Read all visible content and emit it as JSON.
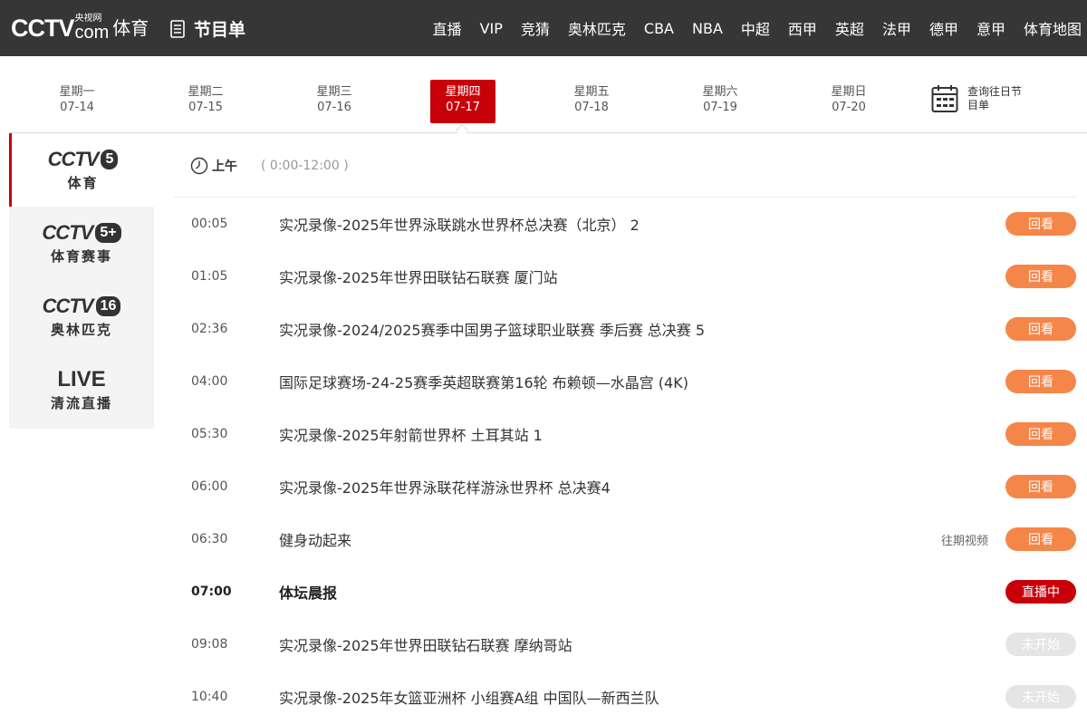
{
  "header": {
    "logo_main": "CCTV",
    "logo_small": "央视网",
    "logo_com": "com",
    "logo_sport": "体育",
    "page_title": "节目单",
    "nav": [
      "直播",
      "VIP",
      "竞猜",
      "奥林匹克",
      "CBA",
      "NBA",
      "中超",
      "西甲",
      "英超",
      "法甲",
      "德甲",
      "意甲",
      "体育地图"
    ]
  },
  "dates": [
    {
      "weekday": "星期一",
      "date": "07-14"
    },
    {
      "weekday": "星期二",
      "date": "07-15"
    },
    {
      "weekday": "星期三",
      "date": "07-16"
    },
    {
      "weekday": "星期四",
      "date": "07-17",
      "active": true
    },
    {
      "weekday": "星期五",
      "date": "07-18"
    },
    {
      "weekday": "星期六",
      "date": "07-19"
    },
    {
      "weekday": "星期日",
      "date": "07-20"
    }
  ],
  "history_label": "查询往日节目单",
  "channels": [
    {
      "name": "CCTV",
      "num": "5",
      "sub": "体育",
      "active": true
    },
    {
      "name": "CCTV",
      "num": "5+",
      "sub": "体育赛事"
    },
    {
      "name": "CCTV",
      "num": "16",
      "sub": "奥林匹克"
    },
    {
      "name": "LIVE",
      "sub": "清流直播"
    }
  ],
  "period": {
    "label": "上午",
    "range": "( 0:00-12:00 )"
  },
  "programs": [
    {
      "time": "00:05",
      "title": "实况录像-2025年世界泳联跳水世界杯总决赛（北京） 2",
      "status": "回看",
      "type": "replay"
    },
    {
      "time": "01:05",
      "title": "实况录像-2025年世界田联钻石联赛 厦门站",
      "status": "回看",
      "type": "replay"
    },
    {
      "time": "02:36",
      "title": "实况录像-2024/2025赛季中国男子篮球职业联赛 季后赛 总决赛 5",
      "status": "回看",
      "type": "replay"
    },
    {
      "time": "04:00",
      "title": "国际足球赛场-24-25赛季英超联赛第16轮 布赖顿—水晶宫 (4K)",
      "status": "回看",
      "type": "replay"
    },
    {
      "time": "05:30",
      "title": "实况录像-2025年射箭世界杯 土耳其站 1",
      "status": "回看",
      "type": "replay"
    },
    {
      "time": "06:00",
      "title": "实况录像-2025年世界泳联花样游泳世界杯 总决赛4",
      "status": "回看",
      "type": "replay"
    },
    {
      "time": "06:30",
      "title": "健身动起来",
      "extra": "往期视频",
      "status": "回看",
      "type": "replay"
    },
    {
      "time": "07:00",
      "title": "体坛晨报",
      "status": "直播中",
      "type": "live"
    },
    {
      "time": "09:08",
      "title": "实况录像-2025年世界田联钻石联赛 摩纳哥站",
      "status": "未开始",
      "type": "notyet"
    },
    {
      "time": "10:40",
      "title": "实况录像-2025年女篮亚洲杯 小组赛A组 中国队—新西兰队",
      "status": "未开始",
      "type": "notyet"
    }
  ]
}
